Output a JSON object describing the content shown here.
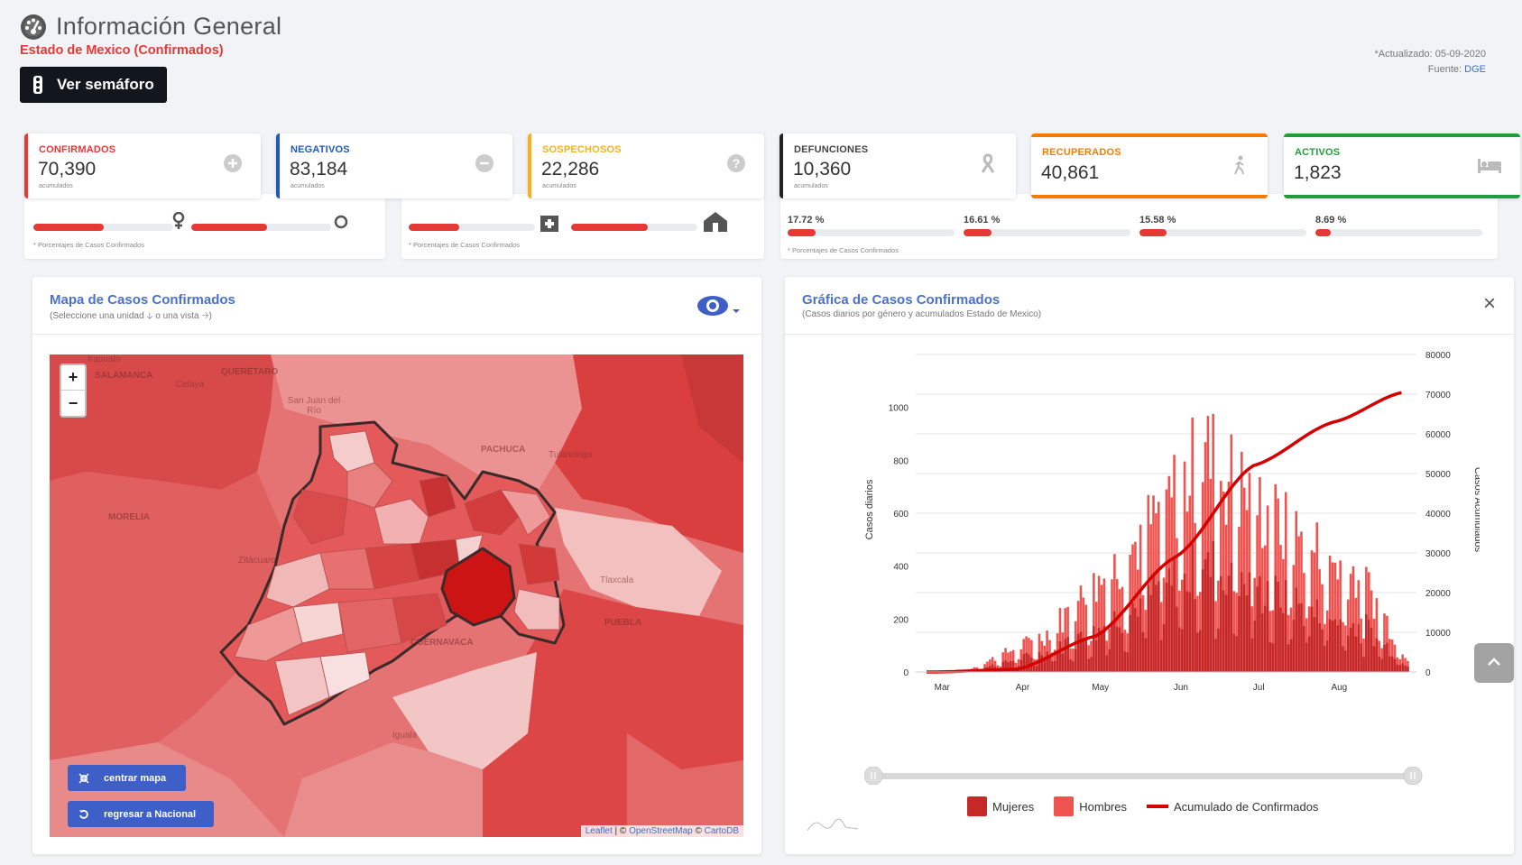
{
  "header": {
    "title": "Información General",
    "subtitle": "Estado de Mexico (Confirmados)",
    "semaforo_label": "Ver semáforo",
    "updated_label": "*Actualizado: 05-09-2020",
    "source_label": "Fuente:",
    "source_link": "DGE"
  },
  "stats": [
    {
      "label": "CONFIRMADOS",
      "value": "70,390",
      "note": "acumulados",
      "color": "#e53935",
      "icon": "plus-circle-icon"
    },
    {
      "label": "NEGATIVOS",
      "value": "83,184",
      "note": "acumulados",
      "color": "#1e5bb8",
      "icon": "minus-circle-icon"
    },
    {
      "label": "SOSPECHOSOS",
      "value": "22,286",
      "note": "acumulados",
      "color": "#f5b21b",
      "icon": "question-circle-icon"
    },
    {
      "label": "DEFUNCIONES",
      "value": "10,360",
      "note": "acumulados",
      "color": "#222222",
      "icon": "ribbon-icon"
    },
    {
      "label": "RECUPERADOS",
      "value": "40,861",
      "note": "",
      "color": "#f57c00",
      "icon": "walking-person-icon"
    },
    {
      "label": "ACTIVOS",
      "value": "1,823",
      "note": "",
      "color": "#1e9e3a",
      "icon": "bed-icon"
    }
  ],
  "back_strip": {
    "gender_left_pct": "",
    "gender_right_pct": "",
    "note": "* Porcentajes  de Casos Confirmados",
    "group_pcts": [
      "17.72 %",
      "16.61 %",
      "15.58 %",
      "8.69 %"
    ],
    "group_fill": [
      0.17,
      0.17,
      0.16,
      0.09
    ],
    "gender_fill": [
      0.5,
      0.54
    ],
    "hosp_fill": [
      0.4,
      0.61
    ]
  },
  "map_panel": {
    "title": "Mapa de Casos Confirmados",
    "subtitle": "(Seleccione una unidad 🡣 o una vista 🡢)",
    "zoom_in": "+",
    "zoom_out": "−",
    "btn_center": "centrar mapa",
    "btn_national": "regresar a Nacional",
    "attrib_leaflet": "Leaflet",
    "attrib_osm": "OpenStreetMap",
    "attrib_carto": "CartoDB",
    "attrib_sep": " | © ",
    "attrib_sep2": " © ",
    "labels": [
      "SALAMANCA",
      "QUERÉTARO",
      "Celaya",
      "San Juan del Río",
      "PACHUCA",
      "Tulancingo",
      "MORELIA",
      "Zitácuaro",
      "Tlaxcala",
      "PUEBLA",
      "CUERNAVACA",
      "Iguala",
      "Irapuato"
    ]
  },
  "chart_panel": {
    "title": "Gráfica de Casos Confirmados",
    "subtitle": "(Casos diarios por género y acumulados Estado de Mexico)",
    "close": "×"
  },
  "chart_data": {
    "type": "bar",
    "ylabel": "Casos diarios",
    "y2label": "Casos Acumulados",
    "ylim": [
      0,
      1200
    ],
    "y2lim": [
      0,
      80000
    ],
    "y_ticks": [
      0,
      200,
      400,
      600,
      800,
      1000
    ],
    "y2_ticks": [
      0,
      10000,
      20000,
      30000,
      40000,
      50000,
      60000,
      70000,
      80000
    ],
    "x_ticks": [
      "Mar",
      "Apr",
      "May",
      "Jun",
      "Jul",
      "Aug"
    ],
    "series": [
      {
        "name": "Mujeres",
        "color": "#c62828"
      },
      {
        "name": "Hombres",
        "color": "#ef5350"
      },
      {
        "name": "Acumulado de Confirmados",
        "color": "#d50000"
      }
    ],
    "monthly_daily_peak": [
      {
        "month": "Mar",
        "value": 5
      },
      {
        "month": "Apr",
        "value": 180
      },
      {
        "month": "May",
        "value": 560
      },
      {
        "month": "Jun",
        "value": 1060
      },
      {
        "month": "Jul",
        "value": 700
      },
      {
        "month": "Aug",
        "value": 450
      }
    ],
    "cumulative_points": [
      {
        "month": "Mar",
        "value": 0
      },
      {
        "month": "Apr",
        "value": 700
      },
      {
        "month": "May",
        "value": 9000
      },
      {
        "month": "Jun",
        "value": 29000
      },
      {
        "month": "Jul",
        "value": 52000
      },
      {
        "month": "Aug",
        "value": 63000
      },
      {
        "month": "end",
        "value": 70390
      }
    ]
  }
}
